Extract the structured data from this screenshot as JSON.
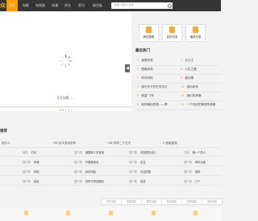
{
  "header": {
    "logo": "众",
    "nav": [
      "首页",
      "电影",
      "电视剧",
      "动漫",
      "综艺",
      "资讯",
      "留言板"
    ],
    "search_placeholder": "请输入影片名称"
  },
  "player": {
    "caption": "正在加载......",
    "progress": 0.0
  },
  "quick_links": [
    "我的观看",
    "我的记录",
    "播放记录"
  ],
  "hot": {
    "title": "最近热门",
    "left": [
      "我想你呢",
      "怪兽弟弟",
      "怀孕妈妈",
      "我在东方苍茫求生记",
      "侠盗·飞车",
      "地球最后的夜——季"
    ],
    "right": [
      "大力士",
      "人生之路",
      "猫头鹰",
      "诛仙前传",
      "我们的故事",
      "一个世纪的黄昏的故事"
    ]
  },
  "list": {
    "title": "推荐",
    "first_row": [
      {
        "name": "纸片人"
      },
      {
        "name": "HD 女大流动夜车",
        "cat": "HD"
      },
      {
        "name": "HD 阿梓二十五天",
        "cat": "HD"
      },
      {
        "name": "2 超级鲨鱼"
      }
    ],
    "rows": [
      [
        {
          "cat": "美剧",
          "name": "灯光"
        },
        {
          "cat": "国产剧",
          "name": "娘要嫁人的宝宝"
        },
        {
          "cat": "国产剧",
          "name": "天堂屋的战士"
        },
        {
          "cat": "日韩",
          "name": "第一个男人"
        }
      ],
      [
        {
          "cat": "国产剧",
          "name": "阿满"
        },
        {
          "cat": "国产剧",
          "name": "不要蔬菜也"
        },
        {
          "cat": "国产剧",
          "name": "正名"
        },
        {
          "cat": "国产剧",
          "name": "风吹水面"
        }
      ],
      [
        {
          "cat": "国产剧",
          "name": "特别"
        },
        {
          "cat": "国产剧",
          "name": "武侠风起"
        },
        {
          "cat": "国产剧",
          "name": "青涩的路"
        },
        {
          "cat": "国产剧",
          "name": "重现"
        }
      ],
      [
        {
          "cat": "国产剧",
          "name": "成全"
        },
        {
          "cat": "国产剧",
          "name": "世界不同的剧情"
        },
        {
          "cat": "国产剧",
          "name": "玩具"
        },
        {
          "cat": "国产剧",
          "name": "三个"
        }
      ]
    ]
  },
  "tags": [
    "动作电影",
    "喜剧电影",
    "爱情电影",
    "科幻电影",
    "恐怖电影",
    "战争电影"
  ],
  "colors": {
    "accent": "#ff9a00",
    "topbar": "#353535"
  }
}
